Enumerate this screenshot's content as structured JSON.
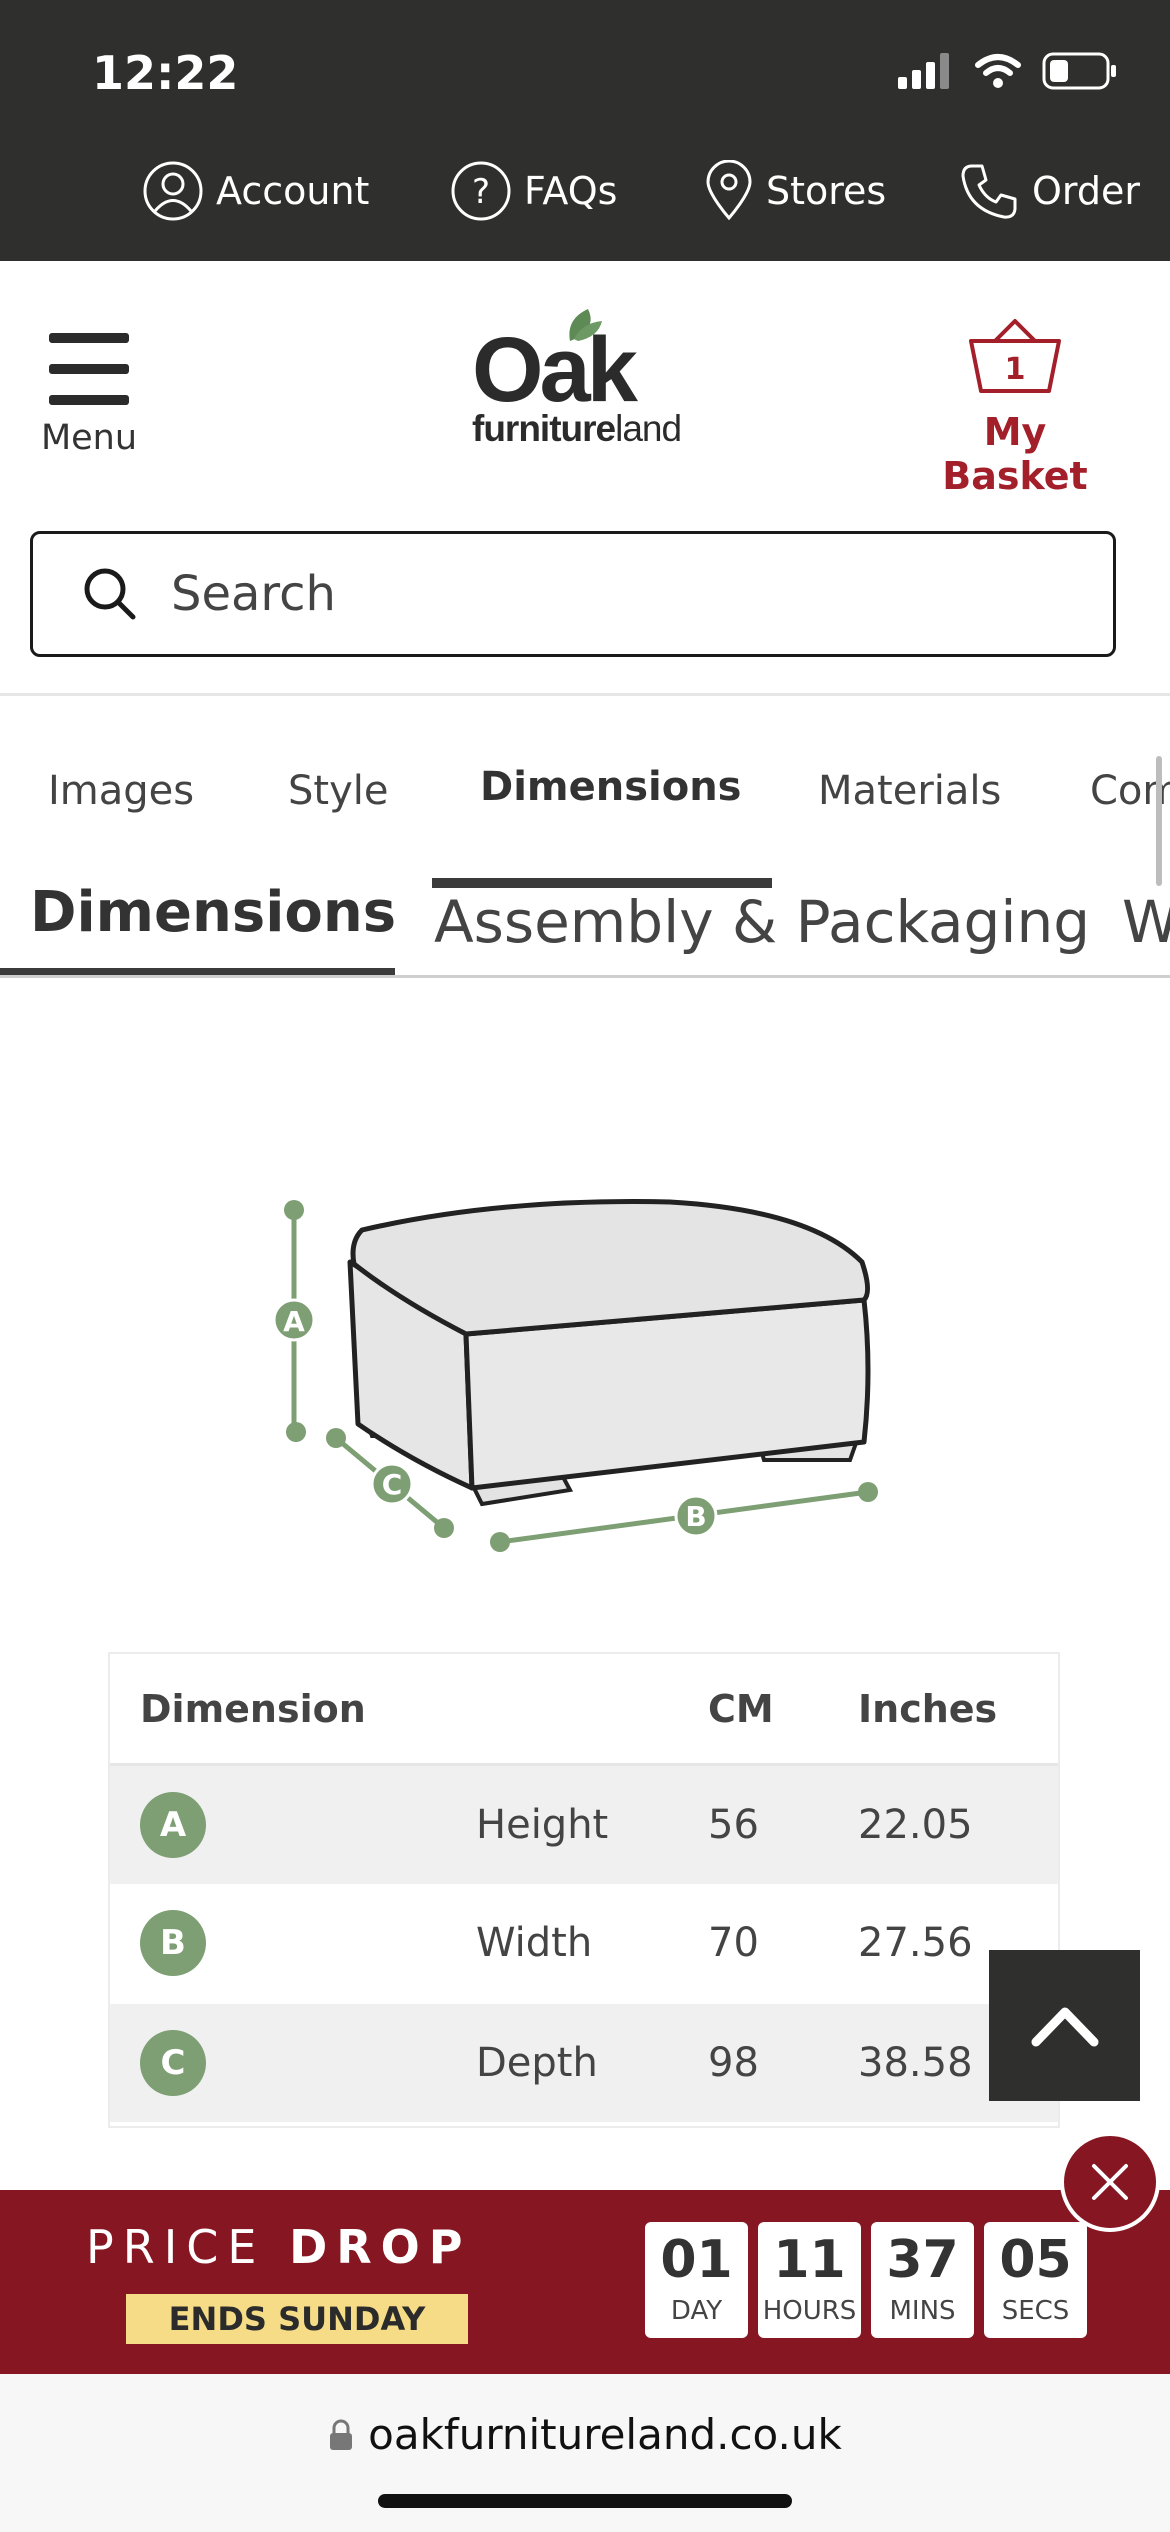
{
  "status_bar": {
    "time": "12:22"
  },
  "utility_nav": [
    {
      "label": "Account",
      "icon": "user-icon"
    },
    {
      "label": "FAQs",
      "icon": "question-icon"
    },
    {
      "label": "Stores",
      "icon": "location-pin-icon"
    },
    {
      "label": "Order",
      "icon": "phone-icon"
    }
  ],
  "header": {
    "menu_label": "Menu",
    "logo": {
      "main": "Oak",
      "sub_bold": "furniture",
      "sub_light": "land"
    },
    "basket_count": "1",
    "basket_label": "My Basket"
  },
  "search": {
    "placeholder": "Search"
  },
  "tabs": [
    {
      "label": "Images",
      "active": false
    },
    {
      "label": "Style",
      "active": false
    },
    {
      "label": "Dimensions",
      "active": true
    },
    {
      "label": "Materials",
      "active": false
    },
    {
      "label": "Com",
      "active": false
    }
  ],
  "subtabs": [
    {
      "label": "Dimensions",
      "active": true
    },
    {
      "label": "Assembly & Packaging",
      "active": false
    },
    {
      "label": "W",
      "active": false
    }
  ],
  "diagram": {
    "labels": [
      "A",
      "B",
      "C"
    ]
  },
  "dimensions_table": {
    "headers": {
      "dimension": "Dimension",
      "cm": "CM",
      "inches": "Inches"
    },
    "rows": [
      {
        "badge": "A",
        "name": "Height",
        "cm": "56",
        "inches": "22.05"
      },
      {
        "badge": "B",
        "name": "Width",
        "cm": "70",
        "inches": "27.56"
      },
      {
        "badge": "C",
        "name": "Depth",
        "cm": "98",
        "inches": "38.58"
      }
    ]
  },
  "promo": {
    "title_light": "PRICE",
    "title_bold": "DROP",
    "subtitle": "ENDS SUNDAY",
    "countdown": [
      {
        "value": "01",
        "unit": "DAY"
      },
      {
        "value": "11",
        "unit": "HOURS"
      },
      {
        "value": "37",
        "unit": "MINS"
      },
      {
        "value": "05",
        "unit": "SECS"
      }
    ]
  },
  "browser": {
    "url": "oakfurnitureland.co.uk"
  },
  "colors": {
    "topbar": "#2f2f2d",
    "brand_red": "#a31f2a",
    "promo_red": "#861722",
    "badge_green": "#7d9f73",
    "promo_yellow": "#f6dc86"
  }
}
